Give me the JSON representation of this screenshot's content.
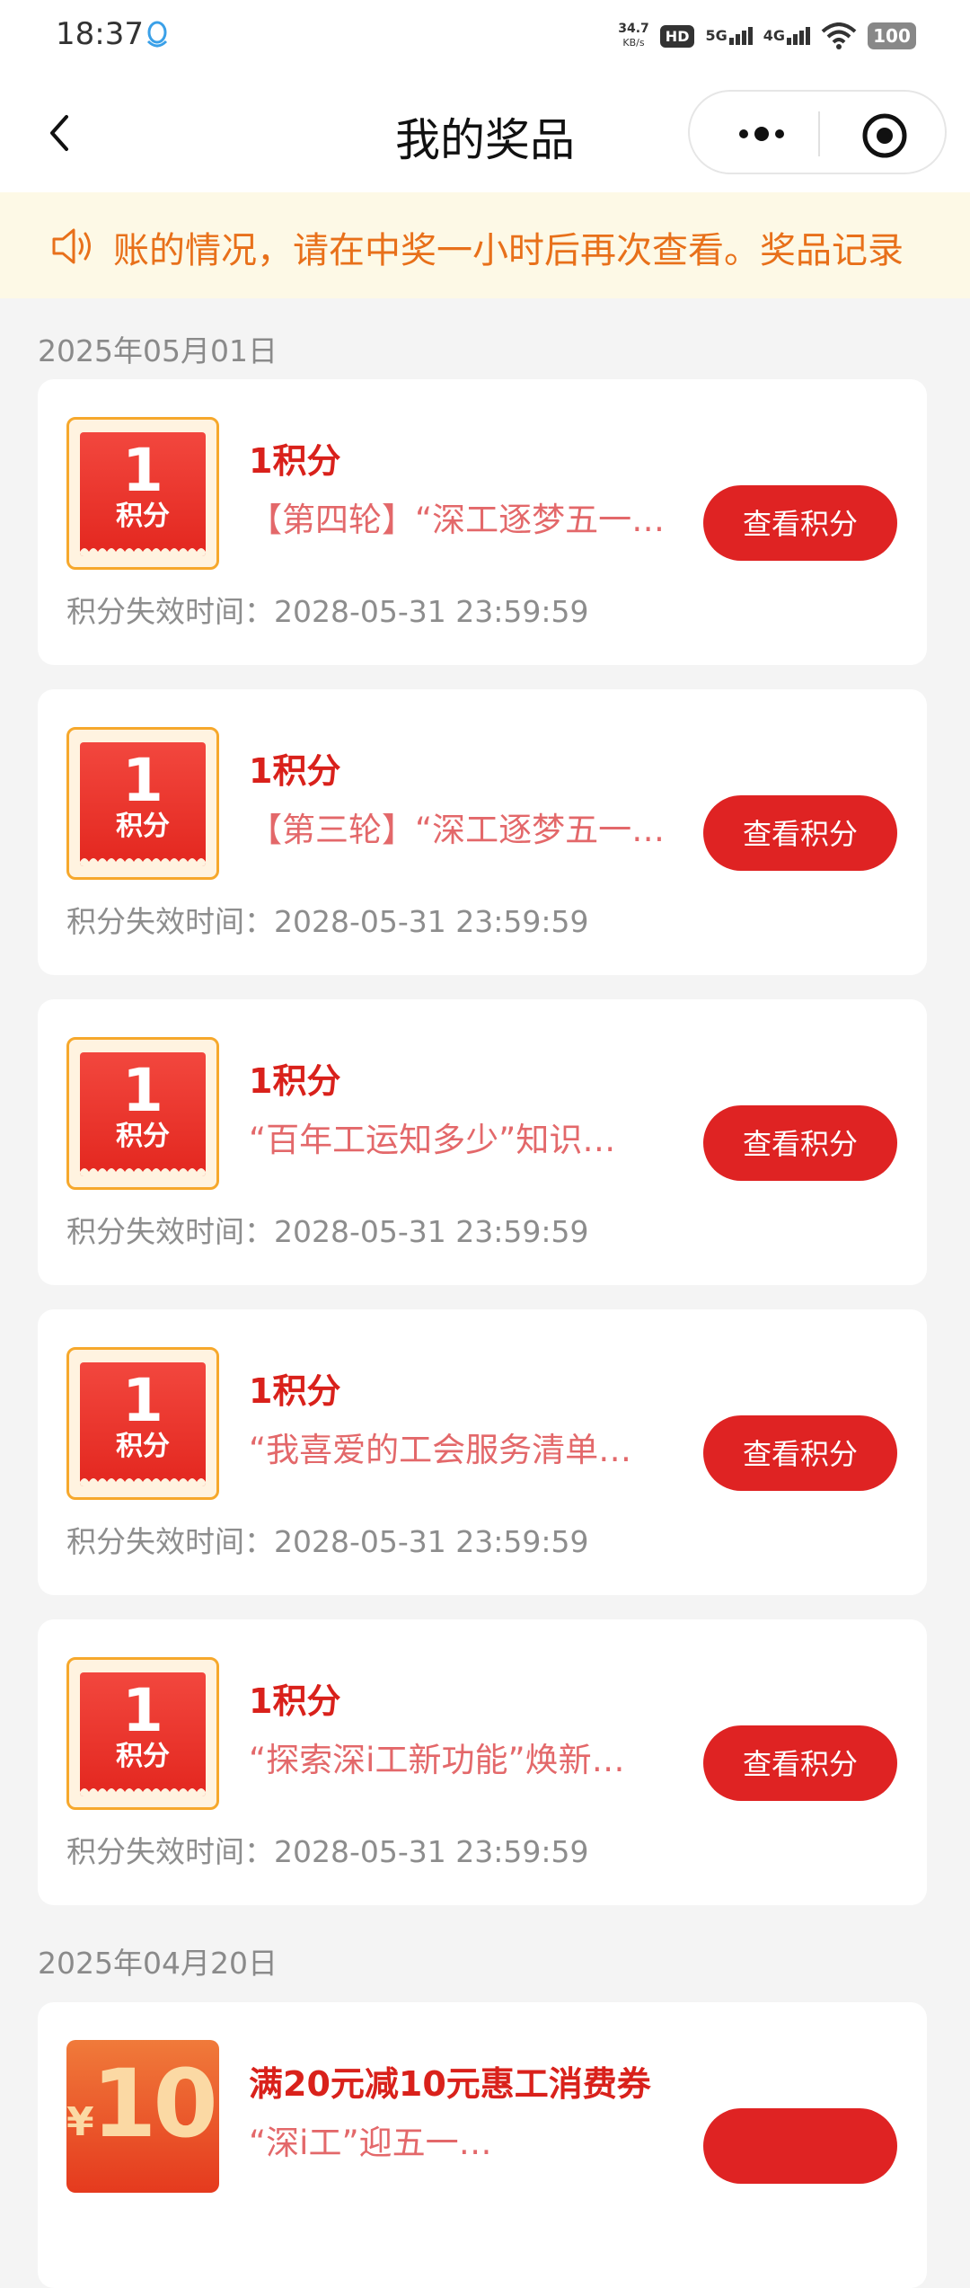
{
  "status_bar": {
    "time": "18:37",
    "speed_value": "34.7",
    "speed_unit": "KB/s",
    "hd": "HD",
    "sim1": "5G",
    "sim2": "4G",
    "battery": "100"
  },
  "nav": {
    "title": "我的奖品"
  },
  "notice": {
    "text": "账的情况，请在中奖一小时后再次查看。奖品记录"
  },
  "groups": [
    {
      "date": "2025年05月01日",
      "items": [
        {
          "badge_num": "1",
          "badge_unit": "积分",
          "name": "1积分",
          "desc": "【第四轮】“深工逐梦五一…",
          "expire": "积分失效时间：2028-05-31 23:59:59",
          "button": "查看积分"
        },
        {
          "badge_num": "1",
          "badge_unit": "积分",
          "name": "1积分",
          "desc": "【第三轮】“深工逐梦五一…",
          "expire": "积分失效时间：2028-05-31 23:59:59",
          "button": "查看积分"
        },
        {
          "badge_num": "1",
          "badge_unit": "积分",
          "name": "1积分",
          "desc": "“百年工运知多少”知识…",
          "expire": "积分失效时间：2028-05-31 23:59:59",
          "button": "查看积分"
        },
        {
          "badge_num": "1",
          "badge_unit": "积分",
          "name": "1积分",
          "desc": "“我喜爱的工会服务清单…",
          "expire": "积分失效时间：2028-05-31 23:59:59",
          "button": "查看积分"
        },
        {
          "badge_num": "1",
          "badge_unit": "积分",
          "name": "1积分",
          "desc": "“探索深i工新功能”焕新…",
          "expire": "积分失效时间：2028-05-31 23:59:59",
          "button": "查看积分"
        }
      ]
    },
    {
      "date": "2025年04月20日",
      "items": [
        {
          "coupon_symbol": "¥",
          "coupon_amount": "10",
          "name": "满20元减10元惠工消费券",
          "desc": "“深i工”迎五一…"
        }
      ]
    }
  ],
  "colors": {
    "accent_red": "#df2323",
    "notice_bg": "#fdf9e6",
    "notice_text": "#e8701a",
    "badge_border": "#f6a82c"
  },
  "icons": {
    "back": "chevron-left-icon",
    "more": "more-dots-icon",
    "close": "target-close-icon",
    "notice": "speaker-icon",
    "qq": "qq-icon"
  }
}
